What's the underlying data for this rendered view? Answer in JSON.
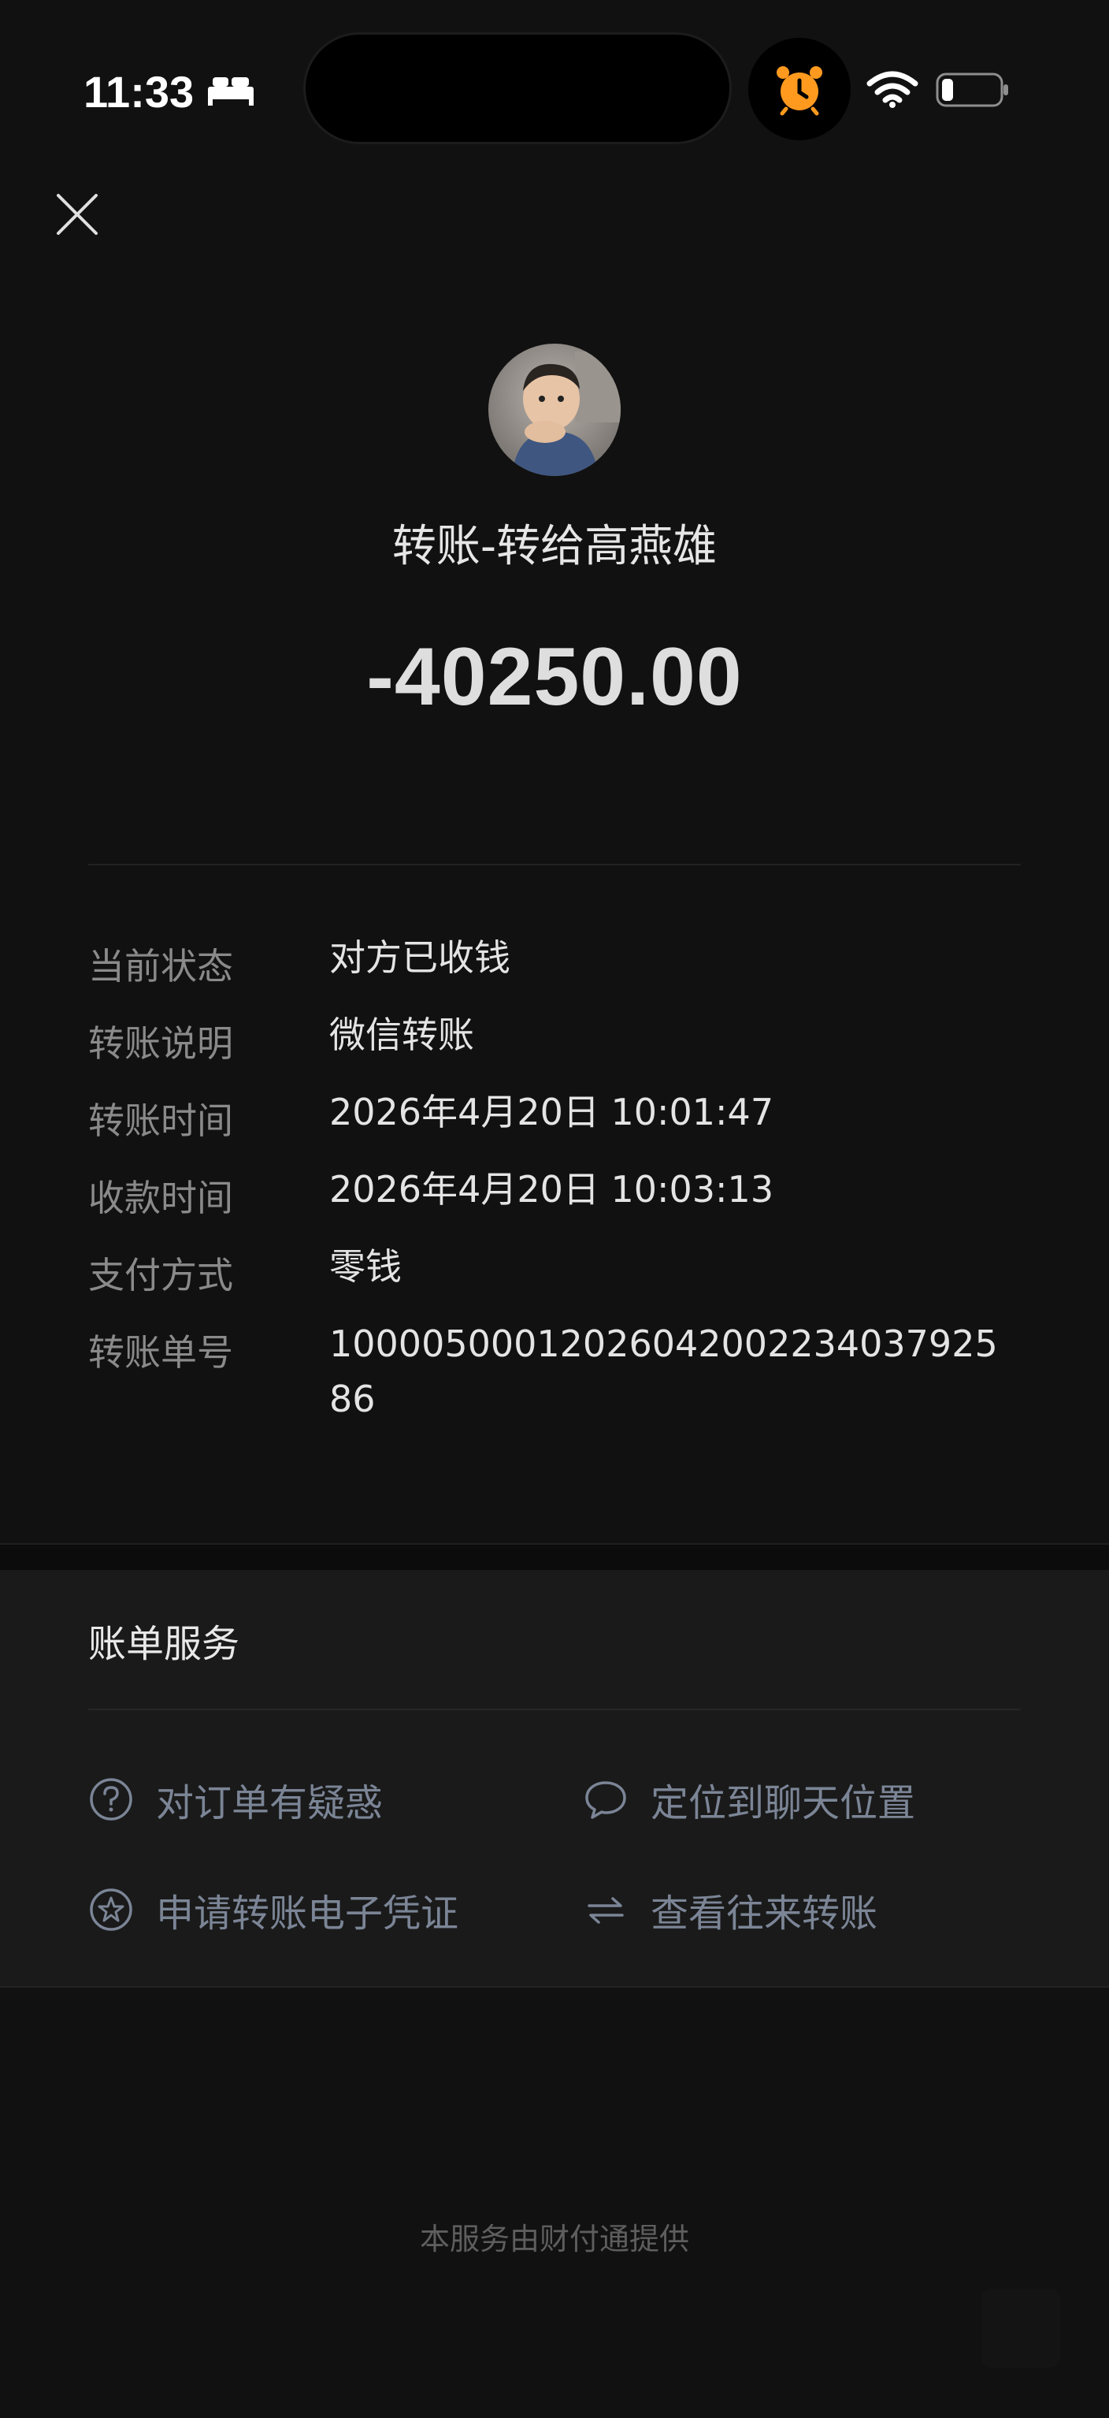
{
  "status_bar": {
    "time": "11:33",
    "sleep_icon": "bed-icon",
    "alarm_icon": "alarm-clock-icon",
    "alarm_color": "#ff9a1f",
    "wifi_icon": "wifi-icon",
    "battery_icon": "battery-low-icon"
  },
  "header": {
    "close_icon": "close-icon",
    "title": "转账-转给高燕雄",
    "amount": "-40250.00"
  },
  "details": [
    {
      "label": "当前状态",
      "value": "对方已收钱"
    },
    {
      "label": "转账说明",
      "value": "微信转账"
    },
    {
      "label": "转账时间",
      "value": "2026年4月20日 10:01:47"
    },
    {
      "label": "收款时间",
      "value": "2026年4月20日 10:03:13"
    },
    {
      "label": "支付方式",
      "value": "零钱"
    },
    {
      "label": "转账单号",
      "value": "1000050001202604200223403792586"
    }
  ],
  "services": {
    "title": "账单服务",
    "items": [
      {
        "label": "对订单有疑惑",
        "icon": "question-circle-icon"
      },
      {
        "label": "定位到聊天位置",
        "icon": "chat-bubble-icon"
      },
      {
        "label": "申请转账电子凭证",
        "icon": "star-badge-icon"
      },
      {
        "label": "查看往来转账",
        "icon": "transfer-arrows-icon"
      }
    ]
  },
  "footer": "本服务由财付通提供"
}
